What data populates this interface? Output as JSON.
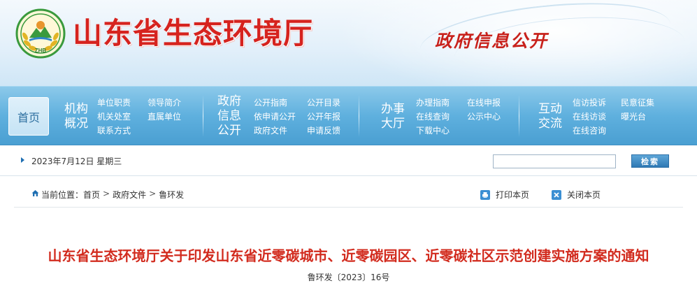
{
  "header": {
    "logo_text": "ZHB",
    "site_title": "山东省生态环境厅",
    "slogan": "政府信息公开"
  },
  "nav": {
    "home_label": "首页",
    "groups": [
      {
        "heading": [
          "机构",
          "概况"
        ],
        "links": [
          "单位职责",
          "领导简介",
          "机关处室",
          "直属单位",
          "联系方式"
        ]
      },
      {
        "heading": [
          "政府",
          "信息",
          "公开"
        ],
        "links": [
          "公开指南",
          "公开目录",
          "依申请公开",
          "公开年报",
          "政府文件",
          "申请反馈"
        ]
      },
      {
        "heading": [
          "办事",
          "大厅"
        ],
        "links": [
          "办理指南",
          "在线申报",
          "在线查询",
          "公示中心",
          "下载中心"
        ]
      },
      {
        "heading": [
          "互动",
          "交流"
        ],
        "links": [
          "信访投诉",
          "民意征集",
          "在线访谈",
          "曝光台",
          "在线咨询"
        ]
      }
    ]
  },
  "datebar": {
    "date": "2023年7月12日 星期三",
    "search_placeholder": "",
    "search_button": "检索"
  },
  "breadcrumb": {
    "prefix": "当前位置：",
    "items": [
      "首页",
      "政府文件",
      "鲁环发"
    ]
  },
  "tools": {
    "print": "打印本页",
    "close": "关闭本页"
  },
  "article": {
    "title": "山东省生态环境厅关于印发山东省近零碳城市、近零碳园区、近零碳社区示范创建实施方案的通知",
    "doc_number": "鲁环发〔2023〕16号"
  },
  "colors": {
    "title_red": "#d6231e",
    "nav_blue": "#5fb0de",
    "logo_green": "#3a9a3d"
  }
}
